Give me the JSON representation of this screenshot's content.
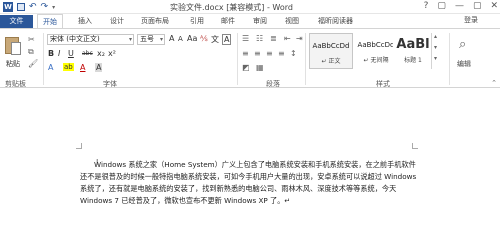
{
  "window": {
    "title": "实验文件.docx [兼容模式] - Word",
    "app_logo": "W",
    "controls": [
      "?",
      "▢",
      "—",
      "▢",
      "✕"
    ]
  },
  "tabs": [
    "文件",
    "开始",
    "插入",
    "设计",
    "页面布局",
    "引用",
    "邮件",
    "审阅",
    "视图",
    "福昕阅读器"
  ],
  "login": "登录",
  "ribbon": {
    "clipboard": {
      "paste": "粘贴",
      "label": "剪贴板"
    },
    "font": {
      "font_name": "宋体 (中文正文)",
      "font_size": "五号",
      "label": "字体",
      "buttons_row1": [
        "A",
        "A",
        "Aa",
        "⅍",
        "文",
        "A"
      ],
      "buttons_row2": [
        "B",
        "I",
        "U",
        "abc",
        "x₂",
        "x²",
        "A",
        "ab",
        "A",
        "A"
      ]
    },
    "paragraph": {
      "label": "段落"
    },
    "styles": {
      "label": "样式",
      "items": [
        {
          "sample": "AaBbCcDd",
          "name": "↵ 正文"
        },
        {
          "sample": "AaBbCcDd",
          "name": "↵ 无间隔"
        },
        {
          "sample": "AaBl",
          "name": "标题 1"
        }
      ]
    },
    "editing": {
      "label": "编辑"
    }
  },
  "document": {
    "text": "Windows 系统之家（Home System）广义上包含了电脑系统安装和手机系统安装，在之前手机软件还不是很普及的时候一般特指电脑系统安装，可如今手机用户大量的出现，安卓系统可以说超过 Windows 系统了，还有就是电脑系统的安装了，找到新熟悉的电脑公司、雨林木风、深度技术等等系统，今天 Windows 7 已经普及了，微软也宣布不更新 Windows XP 了。↵"
  },
  "colors": {
    "accent": "#2b579a"
  }
}
